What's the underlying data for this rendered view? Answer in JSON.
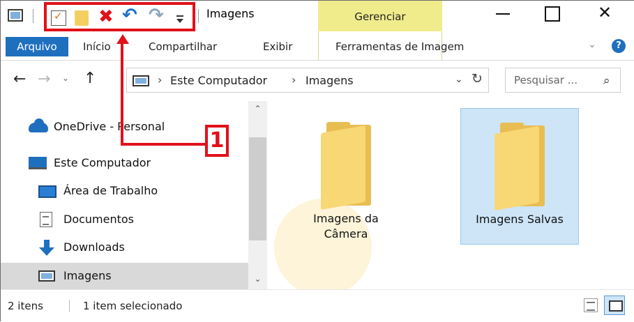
{
  "window": {
    "title": "Imagens",
    "contextual_tab": "Gerenciar",
    "close_glyph": "✕"
  },
  "quick_access_toolbar": {
    "items": [
      "properties-icon",
      "new-folder-icon",
      "delete-icon",
      "undo-icon",
      "redo-icon",
      "customize-dropdown-icon"
    ],
    "delete_glyph": "✖",
    "undo_glyph": "↶",
    "redo_glyph": "↷"
  },
  "ribbon": {
    "tabs": [
      "Arquivo",
      "Início",
      "Compartilhar",
      "Exibir",
      "Ferramentas de Imagem"
    ],
    "chevron_glyph": "⌄",
    "help_glyph": "?"
  },
  "address": {
    "breadcrumbs": [
      "Este Computador",
      "Imagens"
    ],
    "separator": "›",
    "back_glyph": "←",
    "forward_glyph": "→",
    "recent_glyph": "⌄",
    "up_glyph": "↑",
    "dropdown_glyph": "⌄",
    "refresh_glyph": "↻"
  },
  "search": {
    "placeholder": "Pesquisar ...",
    "icon_glyph": "⌕"
  },
  "nav_pane": {
    "items": [
      {
        "label": "OneDrive - Personal",
        "icon": "onedrive-cloud-icon"
      },
      {
        "label": "Este Computador",
        "icon": "computer-icon"
      },
      {
        "label": "Área de Trabalho",
        "icon": "desktop-icon"
      },
      {
        "label": "Documentos",
        "icon": "documents-icon"
      },
      {
        "label": "Downloads",
        "icon": "downloads-icon"
      },
      {
        "label": "Imagens",
        "icon": "pictures-icon",
        "selected": true
      }
    ],
    "scroll_up_glyph": "⌃",
    "scroll_down_glyph": "⌄"
  },
  "content": {
    "folders": [
      {
        "name_line1": "Imagens da",
        "name_line2": "Câmera",
        "selected": false
      },
      {
        "name_line1": "Imagens Salvas",
        "name_line2": "",
        "selected": true
      }
    ]
  },
  "status": {
    "item_count": "2 itens",
    "selection": "1 item selecionado"
  },
  "annotation": {
    "badge": "1",
    "color": "#e0111a"
  },
  "colors": {
    "accent": "#1f6fbf",
    "contextual_tab_bg": "#f0ec8c",
    "selection_bg": "#cde5f7",
    "folder": "#f8d775"
  }
}
